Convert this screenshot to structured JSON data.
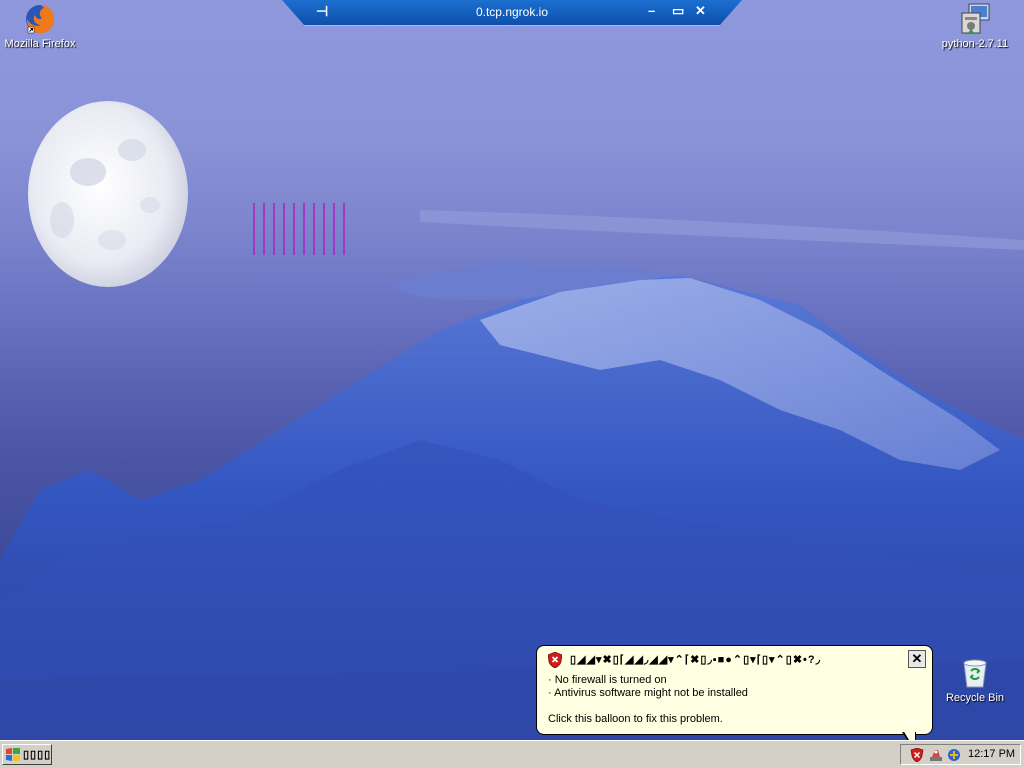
{
  "remote_bar": {
    "title": "0.tcp.ngrok.io",
    "pin_glyph": "⊣",
    "minimize_glyph": "–",
    "restore_glyph": "▭",
    "close_glyph": "✕"
  },
  "desktop_icons": [
    {
      "label": "Mozilla Firefox",
      "icon": "firefox-icon"
    },
    {
      "label": "python-2.7.11",
      "icon": "installer-icon"
    },
    {
      "label": "Recycle Bin",
      "icon": "recycle-bin-icon"
    }
  ],
  "balloon": {
    "title": "▯◢◢▾✖▯⌈◢◢◞◢◢▾⌃⌈✖▯◞▪■●⌃▯▾⌈▯▾⌃▯✖•?◞",
    "close_glyph": "✕",
    "line1": "· No firewall is turned on",
    "line2": "· Antivirus software might not be installed",
    "line3": "Click this balloon to fix this problem."
  },
  "taskbar": {
    "start_label": "▯▯▯▯",
    "clock": "12:17 PM"
  },
  "colors": {
    "rd_bar": "#1560c4",
    "taskbar": "#d4d0c8",
    "balloon_bg": "#ffffe1"
  }
}
